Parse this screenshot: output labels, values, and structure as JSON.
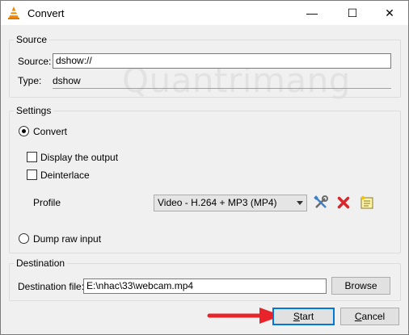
{
  "window": {
    "title": "Convert",
    "min_glyph": "—",
    "max_glyph": "☐",
    "close_glyph": "✕"
  },
  "watermark": "Quantrimang",
  "source": {
    "legend": "Source",
    "source_label": "Source:",
    "source_value": "dshow://",
    "type_label": "Type:",
    "type_value": "dshow"
  },
  "settings": {
    "legend": "Settings",
    "convert_label": "Convert",
    "display_output_label": "Display the output",
    "deinterlace_label": "Deinterlace",
    "profile_label": "Profile",
    "profile_value": "Video - H.264 + MP3 (MP4)",
    "dump_raw_label": "Dump raw input"
  },
  "destination": {
    "legend": "Destination",
    "file_label": "Destination file:",
    "file_value": "E:\\nhac\\33\\webcam.mp4",
    "browse_label": "Browse"
  },
  "footer": {
    "start_first": "S",
    "start_rest": "tart",
    "cancel_first": "C",
    "cancel_rest": "ancel"
  },
  "colors": {
    "accent": "#0078d7",
    "arrow": "#e8232a",
    "delete": "#d8262b"
  }
}
